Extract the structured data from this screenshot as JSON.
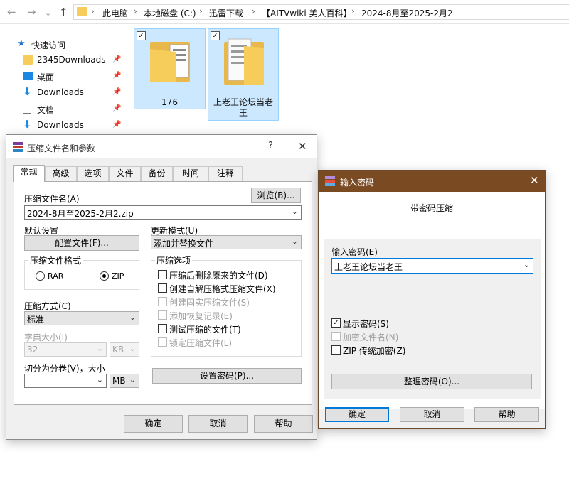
{
  "explorer": {
    "breadcrumbs": [
      "此电脑",
      "本地磁盘 (C:)",
      "迅雷下载",
      "【AITVwiki 美人百科】",
      "2024-8月至2025-2月2"
    ],
    "nav_items": [
      {
        "label": "快速访问"
      },
      {
        "label": "2345Downloads"
      },
      {
        "label": "桌面"
      },
      {
        "label": "Downloads"
      },
      {
        "label": "文档"
      },
      {
        "label": "Downloads"
      }
    ],
    "files": [
      {
        "name": "176",
        "checked": true
      },
      {
        "name": "上老王论坛当老\n王",
        "checked": true
      }
    ]
  },
  "rar_dialog": {
    "title": "压缩文件名和参数",
    "help_glyph": "?",
    "tabs": [
      "常规",
      "高级",
      "选项",
      "文件",
      "备份",
      "时间",
      "注释"
    ],
    "archive_name_label": "压缩文件名(A)",
    "browse_button": "浏览(B)...",
    "archive_name_value": "2024-8月至2025-2月2.zip",
    "default_settings_label": "默认设置",
    "profiles_button": "配置文件(F)...",
    "update_mode_label": "更新模式(U)",
    "update_mode_value": "添加并替换文件",
    "format_label": "压缩文件格式",
    "format_rar": "RAR",
    "format_zip": "ZIP",
    "format_selected": "ZIP",
    "method_label": "压缩方式(C)",
    "method_value": "标准",
    "dict_label": "字典大小(I)",
    "dict_value": "32",
    "dict_unit": "KB",
    "split_label": "切分为分卷(V)，大小",
    "split_unit": "MB",
    "options_label": "压缩选项",
    "options": [
      {
        "label": "压缩后删除原来的文件(D)",
        "checked": false,
        "enabled": true
      },
      {
        "label": "创建自解压格式压缩文件(X)",
        "checked": false,
        "enabled": true
      },
      {
        "label": "创建固实压缩文件(S)",
        "checked": false,
        "enabled": false
      },
      {
        "label": "添加恢复记录(E)",
        "checked": false,
        "enabled": false
      },
      {
        "label": "测试压缩的文件(T)",
        "checked": false,
        "enabled": true
      },
      {
        "label": "锁定压缩文件(L)",
        "checked": false,
        "enabled": false
      }
    ],
    "set_password_button": "设置密码(P)...",
    "ok_button": "确定",
    "cancel_button": "取消",
    "help_button": "帮助"
  },
  "password_dialog": {
    "title": "输入密码",
    "heading": "带密码压缩",
    "password_label": "输入密码(E)",
    "password_value": "上老王论坛当老王",
    "show_password": {
      "label": "显示密码(S)",
      "checked": true
    },
    "encrypt_names": {
      "label": "加密文件名(N)",
      "checked": false,
      "enabled": false
    },
    "zip_legacy": {
      "label": "ZIP 传统加密(Z)",
      "checked": false
    },
    "organize_button": "整理密码(O)...",
    "ok_button": "确定",
    "cancel_button": "取消",
    "help_button": "帮助"
  },
  "colors": {
    "password_titlebar": "#7a4a23",
    "selection_fill": "#cce8ff",
    "default_button_border": "#0078d7"
  }
}
